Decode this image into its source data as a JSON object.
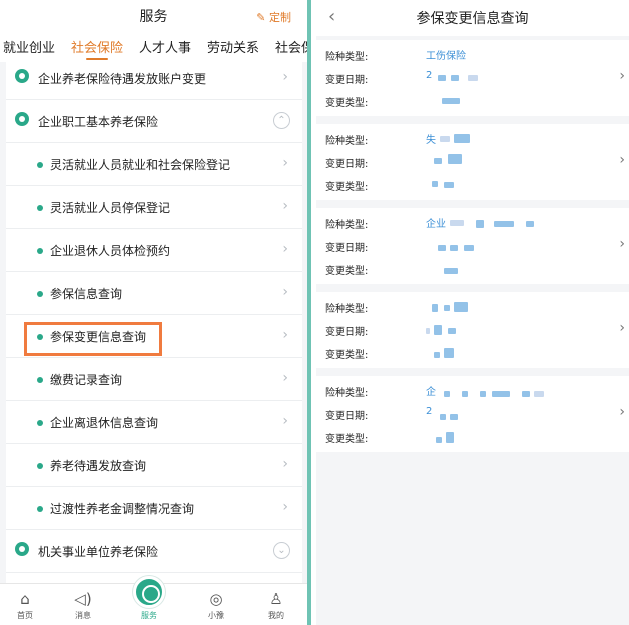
{
  "left": {
    "title": "服务",
    "custom_label": "定制",
    "tabs": [
      "就业创业",
      "社会保险",
      "人才人事",
      "劳动关系",
      "社会保"
    ],
    "active_tab": 1,
    "rows": [
      {
        "label": "企业养老保险待遇发放账户变更",
        "type": "category",
        "chevron": "›"
      },
      {
        "label": "企业职工基本养老保险",
        "type": "category",
        "chevron": "⌃"
      },
      {
        "label": "灵活就业人员就业和社会保险登记",
        "type": "item",
        "chevron": "›"
      },
      {
        "label": "灵活就业人员停保登记",
        "type": "item",
        "chevron": "›"
      },
      {
        "label": "企业退休人员体检预约",
        "type": "item",
        "chevron": "›"
      },
      {
        "label": "参保信息查询",
        "type": "item",
        "chevron": "›"
      },
      {
        "label": "参保变更信息查询",
        "type": "item",
        "chevron": "›",
        "highlighted": true
      },
      {
        "label": "缴费记录查询",
        "type": "item",
        "chevron": "›"
      },
      {
        "label": "企业离退休信息查询",
        "type": "item",
        "chevron": "›"
      },
      {
        "label": "养老待遇发放查询",
        "type": "item",
        "chevron": "›"
      },
      {
        "label": "过渡性养老金调整情况查询",
        "type": "item",
        "chevron": "›"
      },
      {
        "label": "机关事业单位养老保险",
        "type": "category",
        "chevron": "⌄"
      }
    ],
    "bottom_nav": [
      {
        "label": "首页",
        "icon": "home-icon",
        "glyph": "⌂"
      },
      {
        "label": "消息",
        "icon": "speaker-icon",
        "glyph": "◁)"
      },
      {
        "label": "服务",
        "icon": "service-icon",
        "glyph": ""
      },
      {
        "label": "小豫",
        "icon": "assistant-icon",
        "glyph": "◎"
      },
      {
        "label": "我的",
        "icon": "person-icon",
        "glyph": "♙"
      }
    ],
    "accent_color": "#2aa889",
    "tab_active_color": "#e07b2a"
  },
  "right": {
    "back_glyph": "‹",
    "title": "参保变更信息查询",
    "field_labels": [
      "险种类型:",
      "变更日期:",
      "变更类型:"
    ],
    "records": [
      {
        "insurance_type": "工伤保险",
        "change_date": "2",
        "change_type": ""
      },
      {
        "insurance_type": "失",
        "change_date": "",
        "change_type": ""
      },
      {
        "insurance_type": "企业",
        "change_date": "",
        "change_type": ""
      },
      {
        "insurance_type": "",
        "change_date": "",
        "change_type": ""
      },
      {
        "insurance_type": "企",
        "change_date": "2",
        "change_type": ""
      }
    ],
    "chevron": "›",
    "value_color": "#3b8fd6"
  }
}
